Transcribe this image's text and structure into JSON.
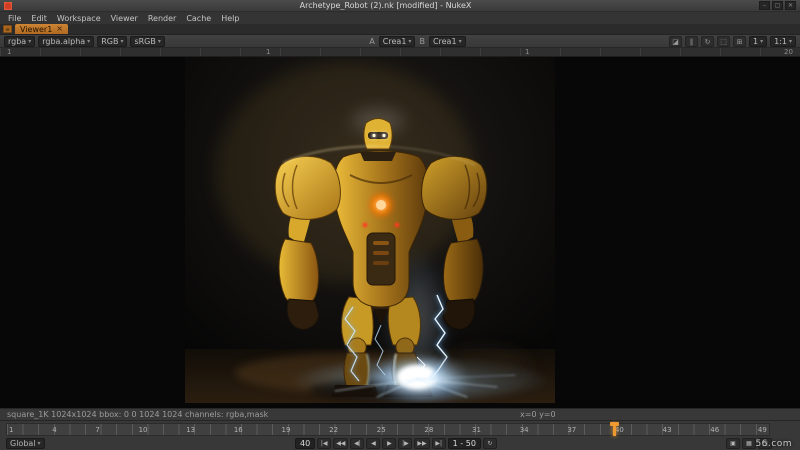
{
  "window": {
    "title": "Archetype_Robot (2).nk [modified] - NukeX",
    "minimize_glyph": "–",
    "maximize_glyph": "▢",
    "close_glyph": "✕"
  },
  "icons": {
    "caret": "▾",
    "tab_close": "×",
    "pane_menu": "≡",
    "proxy": "◪",
    "pause": "∥",
    "refresh": "↻",
    "roi": "⬚",
    "grid": "⊞",
    "loop": "↻",
    "lock": "▣",
    "audio": "▦",
    "flag": "◳"
  },
  "menubar": {
    "items": [
      "File",
      "Edit",
      "Workspace",
      "Viewer",
      "Render",
      "Cache",
      "Help"
    ]
  },
  "tabbar": {
    "active_tab": "Viewer1"
  },
  "viewer_toolbar": {
    "layer": "rgba",
    "alpha": "rgba.alpha",
    "display": "RGB",
    "colorspace": "sRGB",
    "a_label": "A",
    "a_input": "Crea1",
    "b_label": "B",
    "b_input": "Crea1",
    "downrez": "1",
    "zoom": "1:1"
  },
  "viewer_strip": {
    "marks": [
      "1",
      "1",
      "1",
      "20"
    ]
  },
  "statusbar": {
    "format_info": "square_1K 1024x1024   bbox: 0 0 1024 1024   channels: rgba,mask",
    "cursor_info": "x=0 y=0"
  },
  "timeline": {
    "ruler_numbers": [
      "1",
      "4",
      "7",
      "10",
      "13",
      "16",
      "19",
      "22",
      "25",
      "28",
      "31",
      "34",
      "37",
      "40",
      "43",
      "46",
      "49"
    ],
    "current_frame": 40,
    "range_start": 1,
    "range_end": 50,
    "frame_field": "40",
    "range": "1 - 50",
    "global_label": "Global",
    "transport": {
      "go_start": "|◀",
      "prev_key": "◀◀",
      "step_back": "◀|",
      "play_back": "◀",
      "play_fwd": "▶",
      "step_fwd": "|▶",
      "next_key": "▶▶",
      "go_end": "▶|"
    }
  },
  "watermark": "56.com",
  "colors": {
    "accent_orange": "#cc7b2c",
    "playhead_orange": "#ef9a30",
    "robot_yellow": "#e8b93a",
    "glow_blue": "#bfe7ff"
  }
}
